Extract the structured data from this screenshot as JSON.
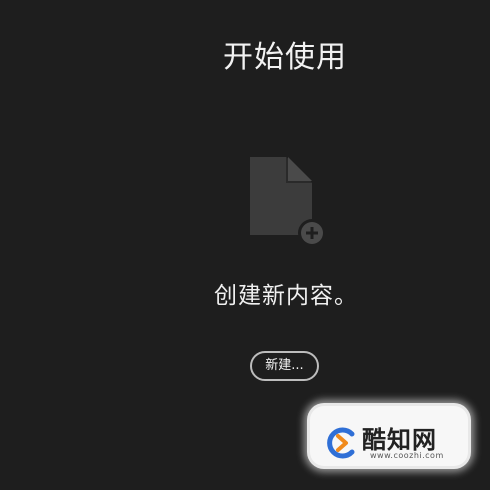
{
  "header": {
    "title": "开始使用"
  },
  "empty_state": {
    "icon": "new-document-icon",
    "message": "创建新内容。"
  },
  "actions": {
    "new_button_label": "新建..."
  },
  "watermark": {
    "name": "酷知网",
    "url": "www.coozhi.com"
  },
  "colors": {
    "background": "#1e1e1e",
    "icon_gray": "#3c3c3c",
    "text": "#f2f2f2",
    "button_border": "#bdbdbd",
    "watermark_blue": "#2f6fd6",
    "watermark_orange": "#f08a1c"
  }
}
